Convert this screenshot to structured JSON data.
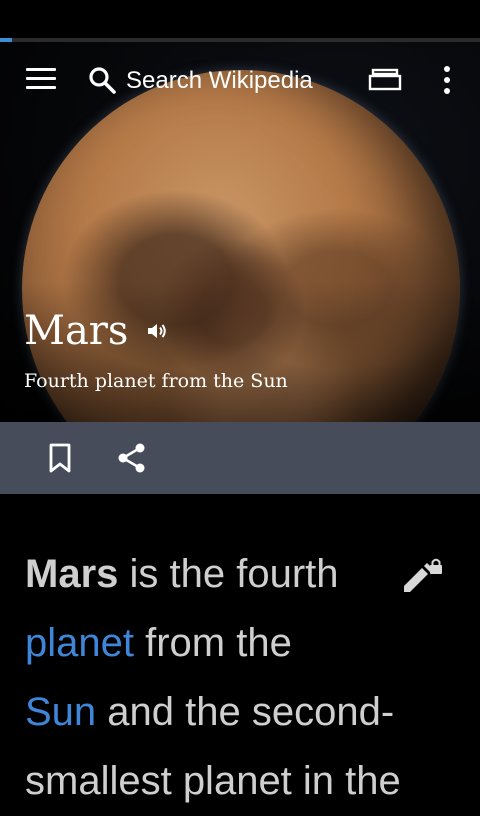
{
  "toolbar": {
    "search_placeholder": "Search Wikipedia",
    "icons": [
      "menu-icon",
      "search-icon",
      "tabs-icon",
      "overflow-icon"
    ]
  },
  "page_load_progress": 0.025,
  "article": {
    "title": "Mars",
    "description": "Fourth planet from the Sun"
  },
  "actions": {
    "icons": [
      "bookmark-icon",
      "share-icon"
    ]
  },
  "content": {
    "line1": {
      "bold": "Mars",
      "text": " is the fourth"
    },
    "line2": {
      "link": "planet",
      "text": " from the"
    },
    "line3": {
      "link": "Sun",
      "text": " and the second-"
    },
    "line4": {
      "text": "smallest planet in the"
    }
  },
  "colors": {
    "accent": "#3a8fd6",
    "link": "#3f86d8",
    "action_bar": "#464c59",
    "body_text": "#cfcfcf"
  }
}
